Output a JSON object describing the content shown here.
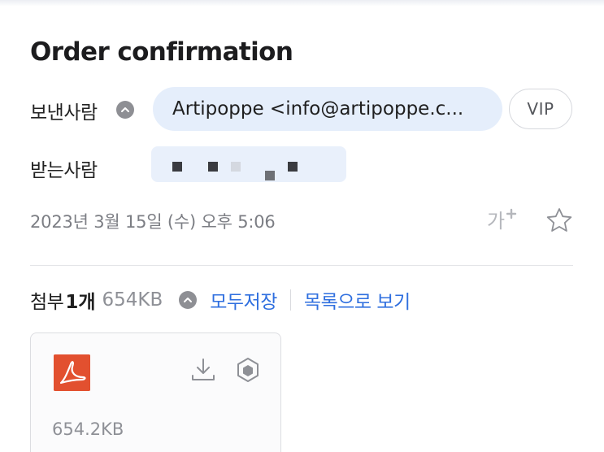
{
  "email": {
    "subject": "Order confirmation",
    "sender_label": "보낸사람",
    "sender_value": "Artipoppe <info@artipoppe.c...",
    "vip_label": "VIP",
    "recipient_label": "받는사람",
    "date": "2023년 3월 15일 (수) 오후 5:06"
  },
  "toolbar": {
    "font_size_icon": "font-size-icon",
    "star_icon": "star-icon"
  },
  "attachments": {
    "title": "첨부",
    "count": "1개",
    "total_size": "654KB",
    "save_all_label": "모두저장",
    "list_view_label": "목록으로 보기",
    "files": [
      {
        "type": "pdf",
        "size": "654.2KB"
      }
    ]
  },
  "colors": {
    "accent": "#2f6fdf",
    "sender_pill_bg": "#e5eefb",
    "pdf_red": "#e2502f",
    "muted_text": "#7c7e84"
  }
}
